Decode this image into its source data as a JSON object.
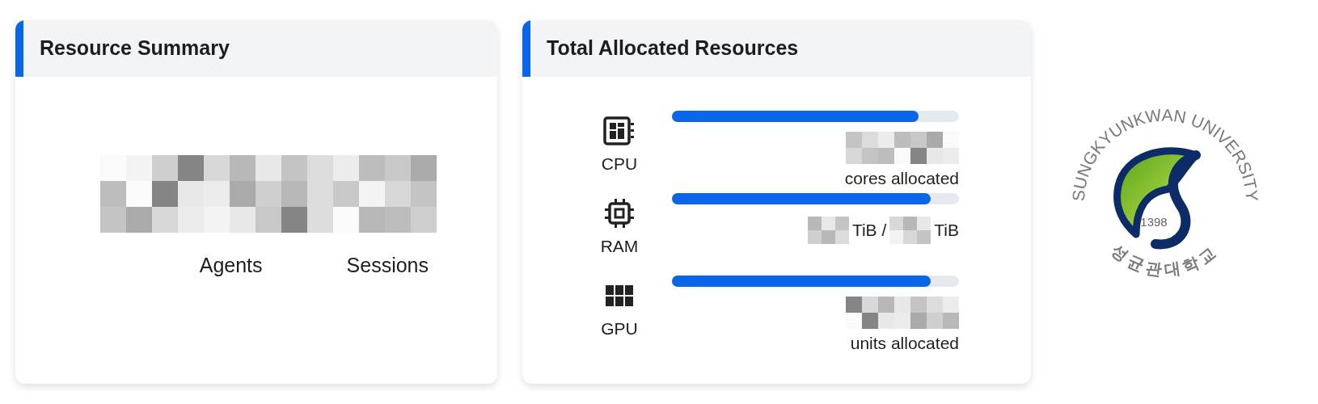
{
  "resource_summary": {
    "title": "Resource Summary",
    "stats": [
      {
        "label": "Agents"
      },
      {
        "label": "Sessions"
      }
    ]
  },
  "allocated": {
    "title": "Total Allocated Resources",
    "resources": [
      {
        "kind": "cpu",
        "label": "CPU",
        "level": 0.86,
        "reading": [
          {
            "kind": "redacted"
          }
        ],
        "caption": "cores allocated"
      },
      {
        "kind": "ram",
        "label": "RAM",
        "level": 0.9,
        "reading": [
          {
            "kind": "redacted"
          },
          {
            "kind": "text",
            "text": "TiB /"
          },
          {
            "kind": "redacted"
          },
          {
            "kind": "text",
            "text": "TiB"
          }
        ]
      },
      {
        "kind": "gpu",
        "label": "GPU",
        "level": 0.9,
        "reading": [
          {
            "kind": "redacted"
          }
        ],
        "caption": "units allocated"
      }
    ]
  },
  "logo": {
    "arc_text": "SUNGKYUNKWAN UNIVERSITY",
    "year": "1398",
    "korean_text": "성균관대학교"
  }
}
